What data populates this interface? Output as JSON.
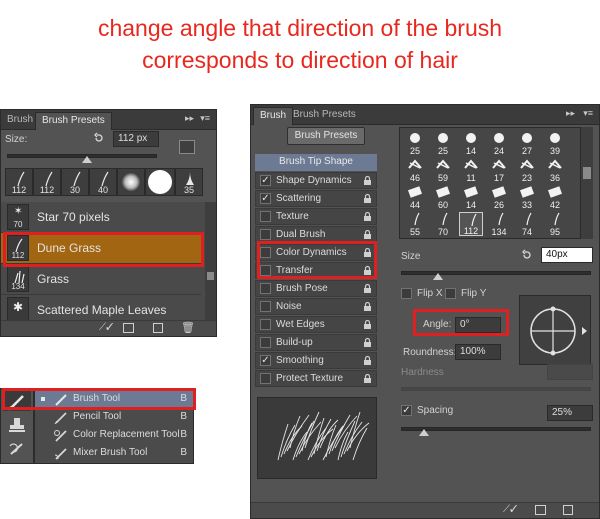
{
  "caption": {
    "line1": "change angle that direction of the brush",
    "line2": "corresponds to direction of hair"
  },
  "presets_panel": {
    "tabs": [
      "Brush",
      "Brush Presets"
    ],
    "size_label": "Size:",
    "size_value": "112 px",
    "thumbs": [
      "112",
      "112",
      "30",
      "40",
      "",
      "",
      "35"
    ],
    "list": [
      {
        "num": "70",
        "name": "Star 70 pixels"
      },
      {
        "num": "112",
        "name": "Dune Grass"
      },
      {
        "num": "134",
        "name": "Grass"
      },
      {
        "num": "",
        "name": "Scattered Maple Leaves"
      }
    ]
  },
  "tools_flyout": {
    "items": [
      {
        "name": "Brush Tool",
        "key": "B"
      },
      {
        "name": "Pencil Tool",
        "key": "B"
      },
      {
        "name": "Color Replacement Tool",
        "key": "B"
      },
      {
        "name": "Mixer Brush Tool",
        "key": "B"
      }
    ]
  },
  "brush_panel": {
    "tabs": [
      "Brush",
      "Brush Presets"
    ],
    "presets_button": "Brush Presets",
    "tip_shape_header": "Brush Tip Shape",
    "options": [
      {
        "label": "Shape Dynamics",
        "checked": true
      },
      {
        "label": "Scattering",
        "checked": true
      },
      {
        "label": "Texture",
        "checked": false
      },
      {
        "label": "Dual Brush",
        "checked": false
      },
      {
        "label": "Color Dynamics",
        "checked": false
      },
      {
        "label": "Transfer",
        "checked": false
      },
      {
        "label": "Brush Pose",
        "checked": false
      },
      {
        "label": "Noise",
        "checked": false
      },
      {
        "label": "Wet Edges",
        "checked": false
      },
      {
        "label": "Build-up",
        "checked": false
      },
      {
        "label": "Smoothing",
        "checked": true
      },
      {
        "label": "Protect Texture",
        "checked": false
      }
    ],
    "grid_numbers": [
      "25",
      "25",
      "14",
      "24",
      "27",
      "39",
      "46",
      "59",
      "11",
      "17",
      "23",
      "36",
      "44",
      "60",
      "14",
      "26",
      "33",
      "42",
      "55",
      "70",
      "112",
      "134",
      "74",
      "95"
    ],
    "size_label": "Size",
    "size_value": "40px",
    "flip_x": "Flip X",
    "flip_y": "Flip Y",
    "angle_label": "Angle:",
    "angle_value": "0°",
    "roundness_label": "Roundness:",
    "roundness_value": "100%",
    "hardness_label": "Hardness",
    "spacing_label": "Spacing",
    "spacing_value": "25%",
    "spacing_checked": "✓"
  }
}
